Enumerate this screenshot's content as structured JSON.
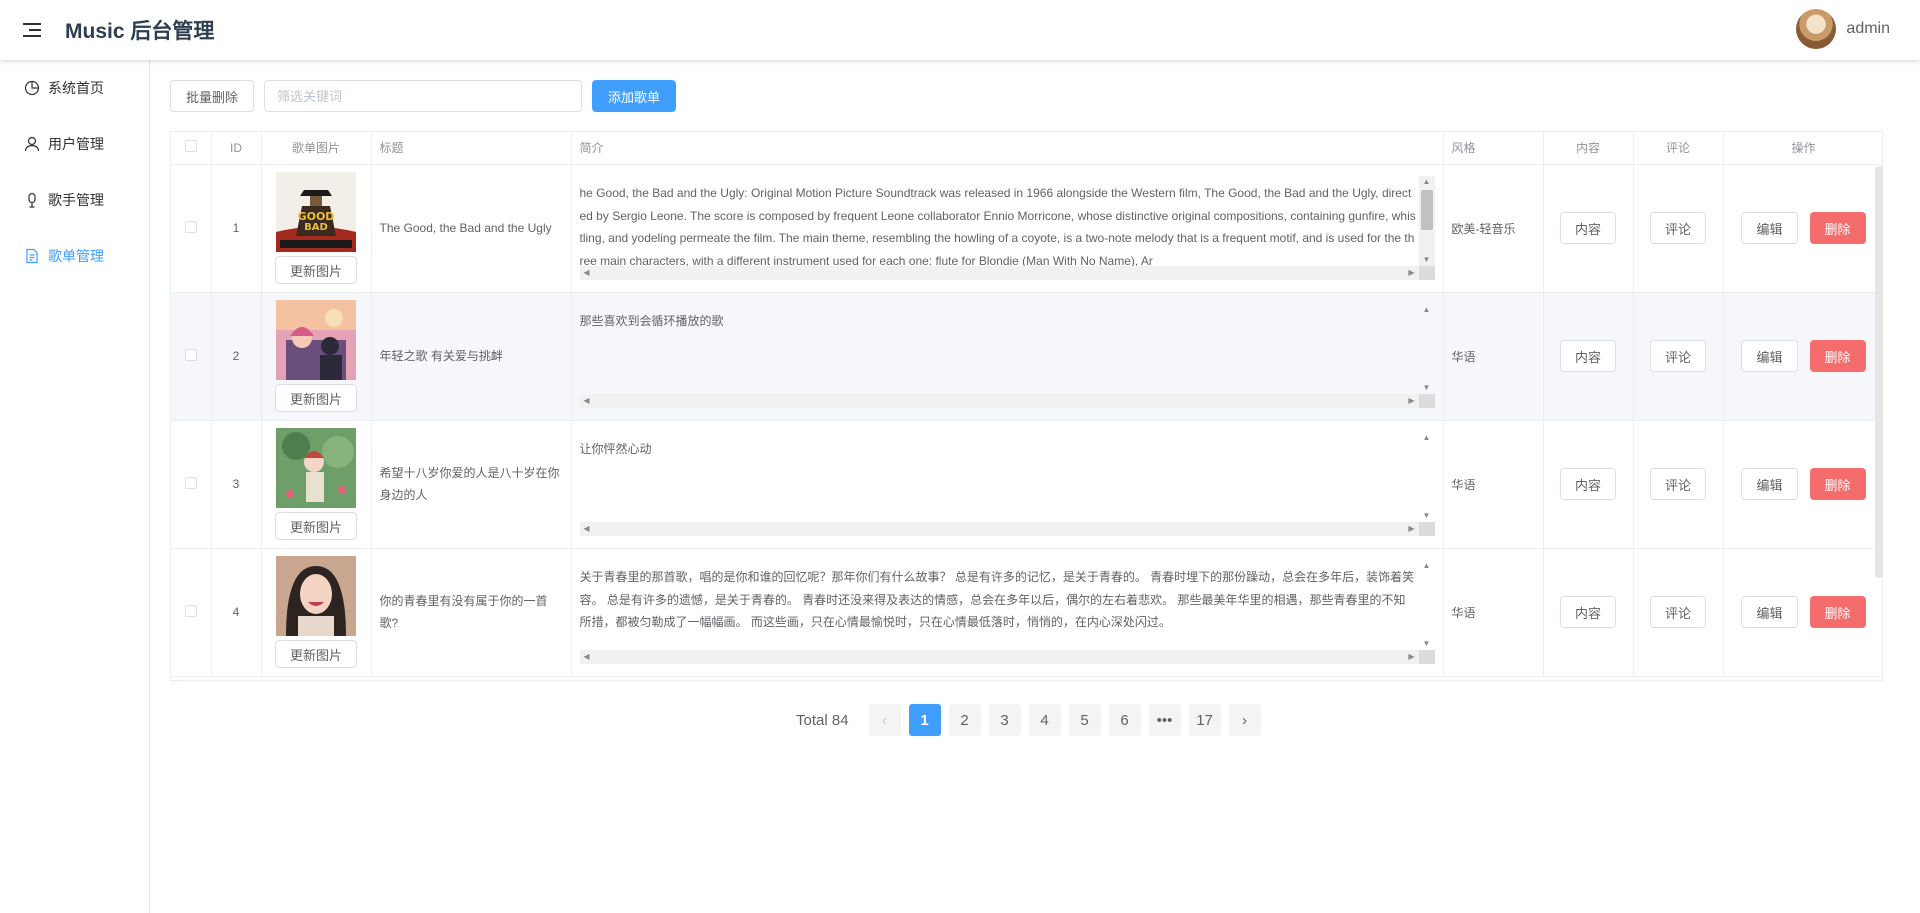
{
  "header": {
    "title": "Music 后台管理",
    "username": "admin"
  },
  "sidebar": {
    "items": [
      {
        "label": "系统首页",
        "icon": "pie-chart-icon",
        "active": false
      },
      {
        "label": "用户管理",
        "icon": "user-icon",
        "active": false
      },
      {
        "label": "歌手管理",
        "icon": "microphone-icon",
        "active": false
      },
      {
        "label": "歌单管理",
        "icon": "document-icon",
        "active": true
      }
    ]
  },
  "toolbar": {
    "batch_delete_label": "批量删除",
    "search_placeholder": "筛选关键词",
    "search_value": "",
    "add_label": "添加歌单"
  },
  "table": {
    "headers": [
      "ID",
      "歌单图片",
      "标题",
      "简介",
      "风格",
      "内容",
      "评论",
      "操作"
    ],
    "update_image_label": "更新图片",
    "content_label": "内容",
    "comment_label": "评论",
    "edit_label": "编辑",
    "delete_label": "删除",
    "rows": [
      {
        "id": "1",
        "title": "The Good, the Bad and the Ugly",
        "intro": "he Good, the Bad and the Ugly: Original Motion Picture Soundtrack was released in 1966 alongside the Western film, The Good, the Bad and the Ugly, directed by Sergio Leone. The score is composed by frequent Leone collaborator Ennio Morricone, whose distinctive original compositions, containing gunfire, whistling, and yodeling permeate the film. The main theme, resembling the howling of a coyote, is a two-note melody that is a frequent motif, and is used for the three main characters, with a different instrument used for each one: flute for Blondie (Man With No Name), Ar",
        "style": "欧美-轻音乐",
        "cover": "western-poster"
      },
      {
        "id": "2",
        "title": "年轻之歌 有关爱与挑衅",
        "intro": "那些喜欢到会循环播放的歌",
        "style": "华语",
        "cover": "anime-girl-sunset"
      },
      {
        "id": "3",
        "title": "希望十八岁你爱的人是八十岁在你身边的人",
        "intro": "让你怦然心动",
        "style": "华语",
        "cover": "anime-green-field"
      },
      {
        "id": "4",
        "title": "你的青春里有没有属于你的一首歌?",
        "intro": "关于青春里的那首歌，唱的是你和谁的回忆呢？那年你们有什么故事？ 总是有许多的记忆，是关于青春的。 青春时埋下的那份躁动，总会在多年后，装饰着笑容。 总是有许多的遗憾，是关于青春的。 青春时还没来得及表达的情感，总会在多年以后，偶尔的左右着悲欢。 那些最美年华里的相遇，那些青春里的不知所措，都被匀勒成了一幅幅画。 而这些画，只在心情最愉悦时，只在心情最低落时，悄悄的，在内心深处闪过。",
        "style": "华语",
        "cover": "smiling-woman"
      }
    ]
  },
  "pagination": {
    "total_label": "Total 84",
    "pages": [
      "1",
      "2",
      "3",
      "4",
      "5",
      "6",
      "•••",
      "17"
    ],
    "current": "1",
    "prev_icon": "chevron-left-icon",
    "next_icon": "chevron-right-icon"
  },
  "colors": {
    "primary": "#409eff",
    "danger": "#f56c6c",
    "border": "#ebeef5"
  }
}
